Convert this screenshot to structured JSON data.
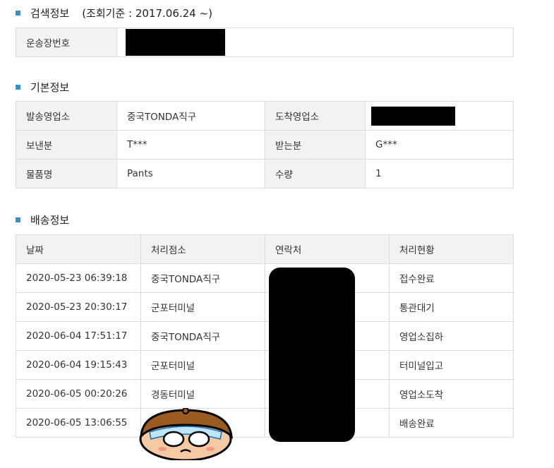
{
  "search": {
    "title": "검색정보",
    "subtitle": "(조회기준 : 2017.06.24 ~)",
    "tracking_label": "운송장번호"
  },
  "basic": {
    "title": "기본정보",
    "rows": [
      {
        "l1": "발송영업소",
        "v1": "중국TONDA직구",
        "l2": "도착영업소",
        "v2": ""
      },
      {
        "l1": "보낸분",
        "v1": "T***",
        "l2": "받는분",
        "v2": "G***"
      },
      {
        "l1": "물품명",
        "v1": "Pants",
        "l2": "수량",
        "v2": "1"
      }
    ]
  },
  "delivery": {
    "title": "배송정보",
    "headers": [
      "날짜",
      "처리점소",
      "연락처",
      "처리현황"
    ],
    "rows": [
      {
        "date": "2020-05-23 06:39:18",
        "branch": "중국TONDA직구",
        "status": "접수완료"
      },
      {
        "date": "2020-05-23 20:30:17",
        "branch": "군포터미널",
        "status": "통관대기"
      },
      {
        "date": "2020-06-04 17:51:17",
        "branch": "중국TONDA직구",
        "status": "영업소집하"
      },
      {
        "date": "2020-06-04 19:15:43",
        "branch": "군포터미널",
        "status": "터미널입고"
      },
      {
        "date": "2020-06-05 00:20:26",
        "branch": "경동터미널",
        "status": "영업소도착"
      },
      {
        "date": "2020-06-05 13:06:55",
        "branch": "",
        "status": "배송완료"
      }
    ]
  },
  "colors": {
    "bullet": "#3a8fc9",
    "label_bg": "#f2f2f2",
    "border": "#dcdcdc"
  }
}
